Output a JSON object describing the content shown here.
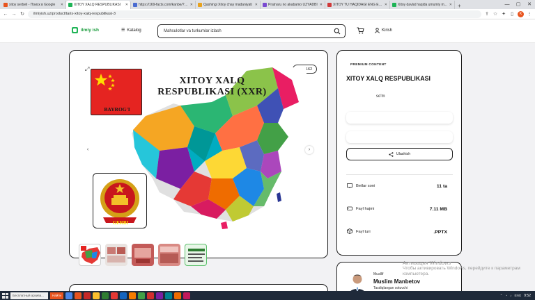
{
  "browser": {
    "tabs": [
      {
        "title": "xitoy serbeli - Поиск в Google",
        "color": "#e8541e",
        "active": false
      },
      {
        "title": "XITOY XALQ RESPUBLIKASI",
        "color": "#1fb456",
        "active": true
      },
      {
        "title": "https://169-facts.com/kanbe/?u=...",
        "color": "#4a6bd0",
        "active": false
      },
      {
        "title": "Qashingi Xitoy chay madaniyati",
        "color": "#e8a21e",
        "active": false
      },
      {
        "title": "Pratnaru no akabamo UZYADBI",
        "color": "#7a4ad0",
        "active": false
      },
      {
        "title": "XITOY TU HAQIDAGI ENG EGZI...",
        "color": "#d03a3a",
        "active": false
      },
      {
        "title": "Xitoy davlat haqida umumiy m...",
        "color": "#1fb456",
        "active": false
      }
    ],
    "url": "ilmiyish.uz/product/taris-xitoy-xalq-respublikasi-3",
    "profile_initial": "K"
  },
  "header": {
    "logo": "ilmiy ish",
    "catalog": "Katalog",
    "search_placeholder": "Mahsulotlar va turkumlar izlash",
    "login": "Kirish"
  },
  "gallery": {
    "views": "162",
    "slide_title": "XITOY XALQ RESPUBLIKASI (XXR)",
    "flag_label": "BAYROG'I",
    "emblem_label": "GERBI",
    "thumb_count": 5
  },
  "info": {
    "badge": "PREMIUM CONTENT",
    "title": "XITOY XALQ RESPUBLIKASI",
    "price_currency": "so'm",
    "share": "Ulashish",
    "stats": [
      {
        "icon": "slides-icon",
        "label": "Betlar soni",
        "value": "11 ta"
      },
      {
        "icon": "drive-icon",
        "label": "Fayl hajmi",
        "value": "7.11 MB"
      },
      {
        "icon": "file-type-icon",
        "label": "Fayl turi",
        "value": ".PPTX"
      }
    ]
  },
  "author": {
    "role": "Muallif",
    "name": "Muslim Manbetov",
    "status": "Tasdiqlangan sotuvchi"
  },
  "watermark": {
    "line1": "Активация Windows",
    "line2": "Чтобы активировать Windows, перейдите к параметрам",
    "line3": "компьютера."
  },
  "taskbar": {
    "search_text": "Бесплатный архива...",
    "naiti": "Найти",
    "lang": "ENG",
    "time": "9:52"
  }
}
